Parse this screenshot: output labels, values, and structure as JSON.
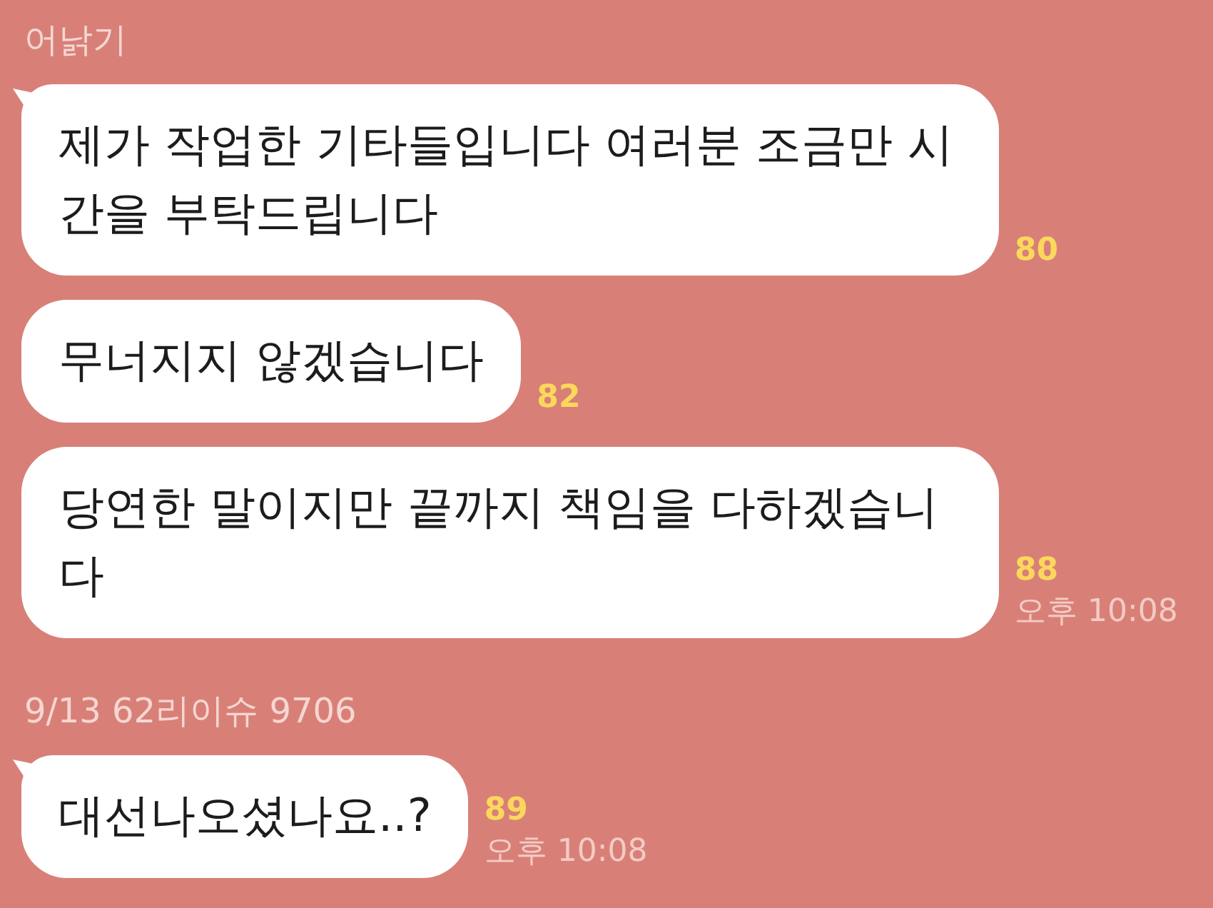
{
  "groups": [
    {
      "sender": "어낡기",
      "messages": [
        {
          "text": "제가 작업한 기타들입니다 여러분 조금만 시간을 부탁드립니다",
          "unread": "80"
        },
        {
          "text": "무너지지 않겠습니다",
          "unread": "82"
        },
        {
          "text": "당연한 말이지만 끝까지 책임을 다하겠습니다",
          "unread": "88",
          "time": "오후 10:08"
        }
      ]
    },
    {
      "sender": "9/13 62리이슈 9706",
      "messages": [
        {
          "text": "대선나오셨나요..?",
          "unread": "89",
          "time": "오후 10:08"
        }
      ]
    }
  ]
}
